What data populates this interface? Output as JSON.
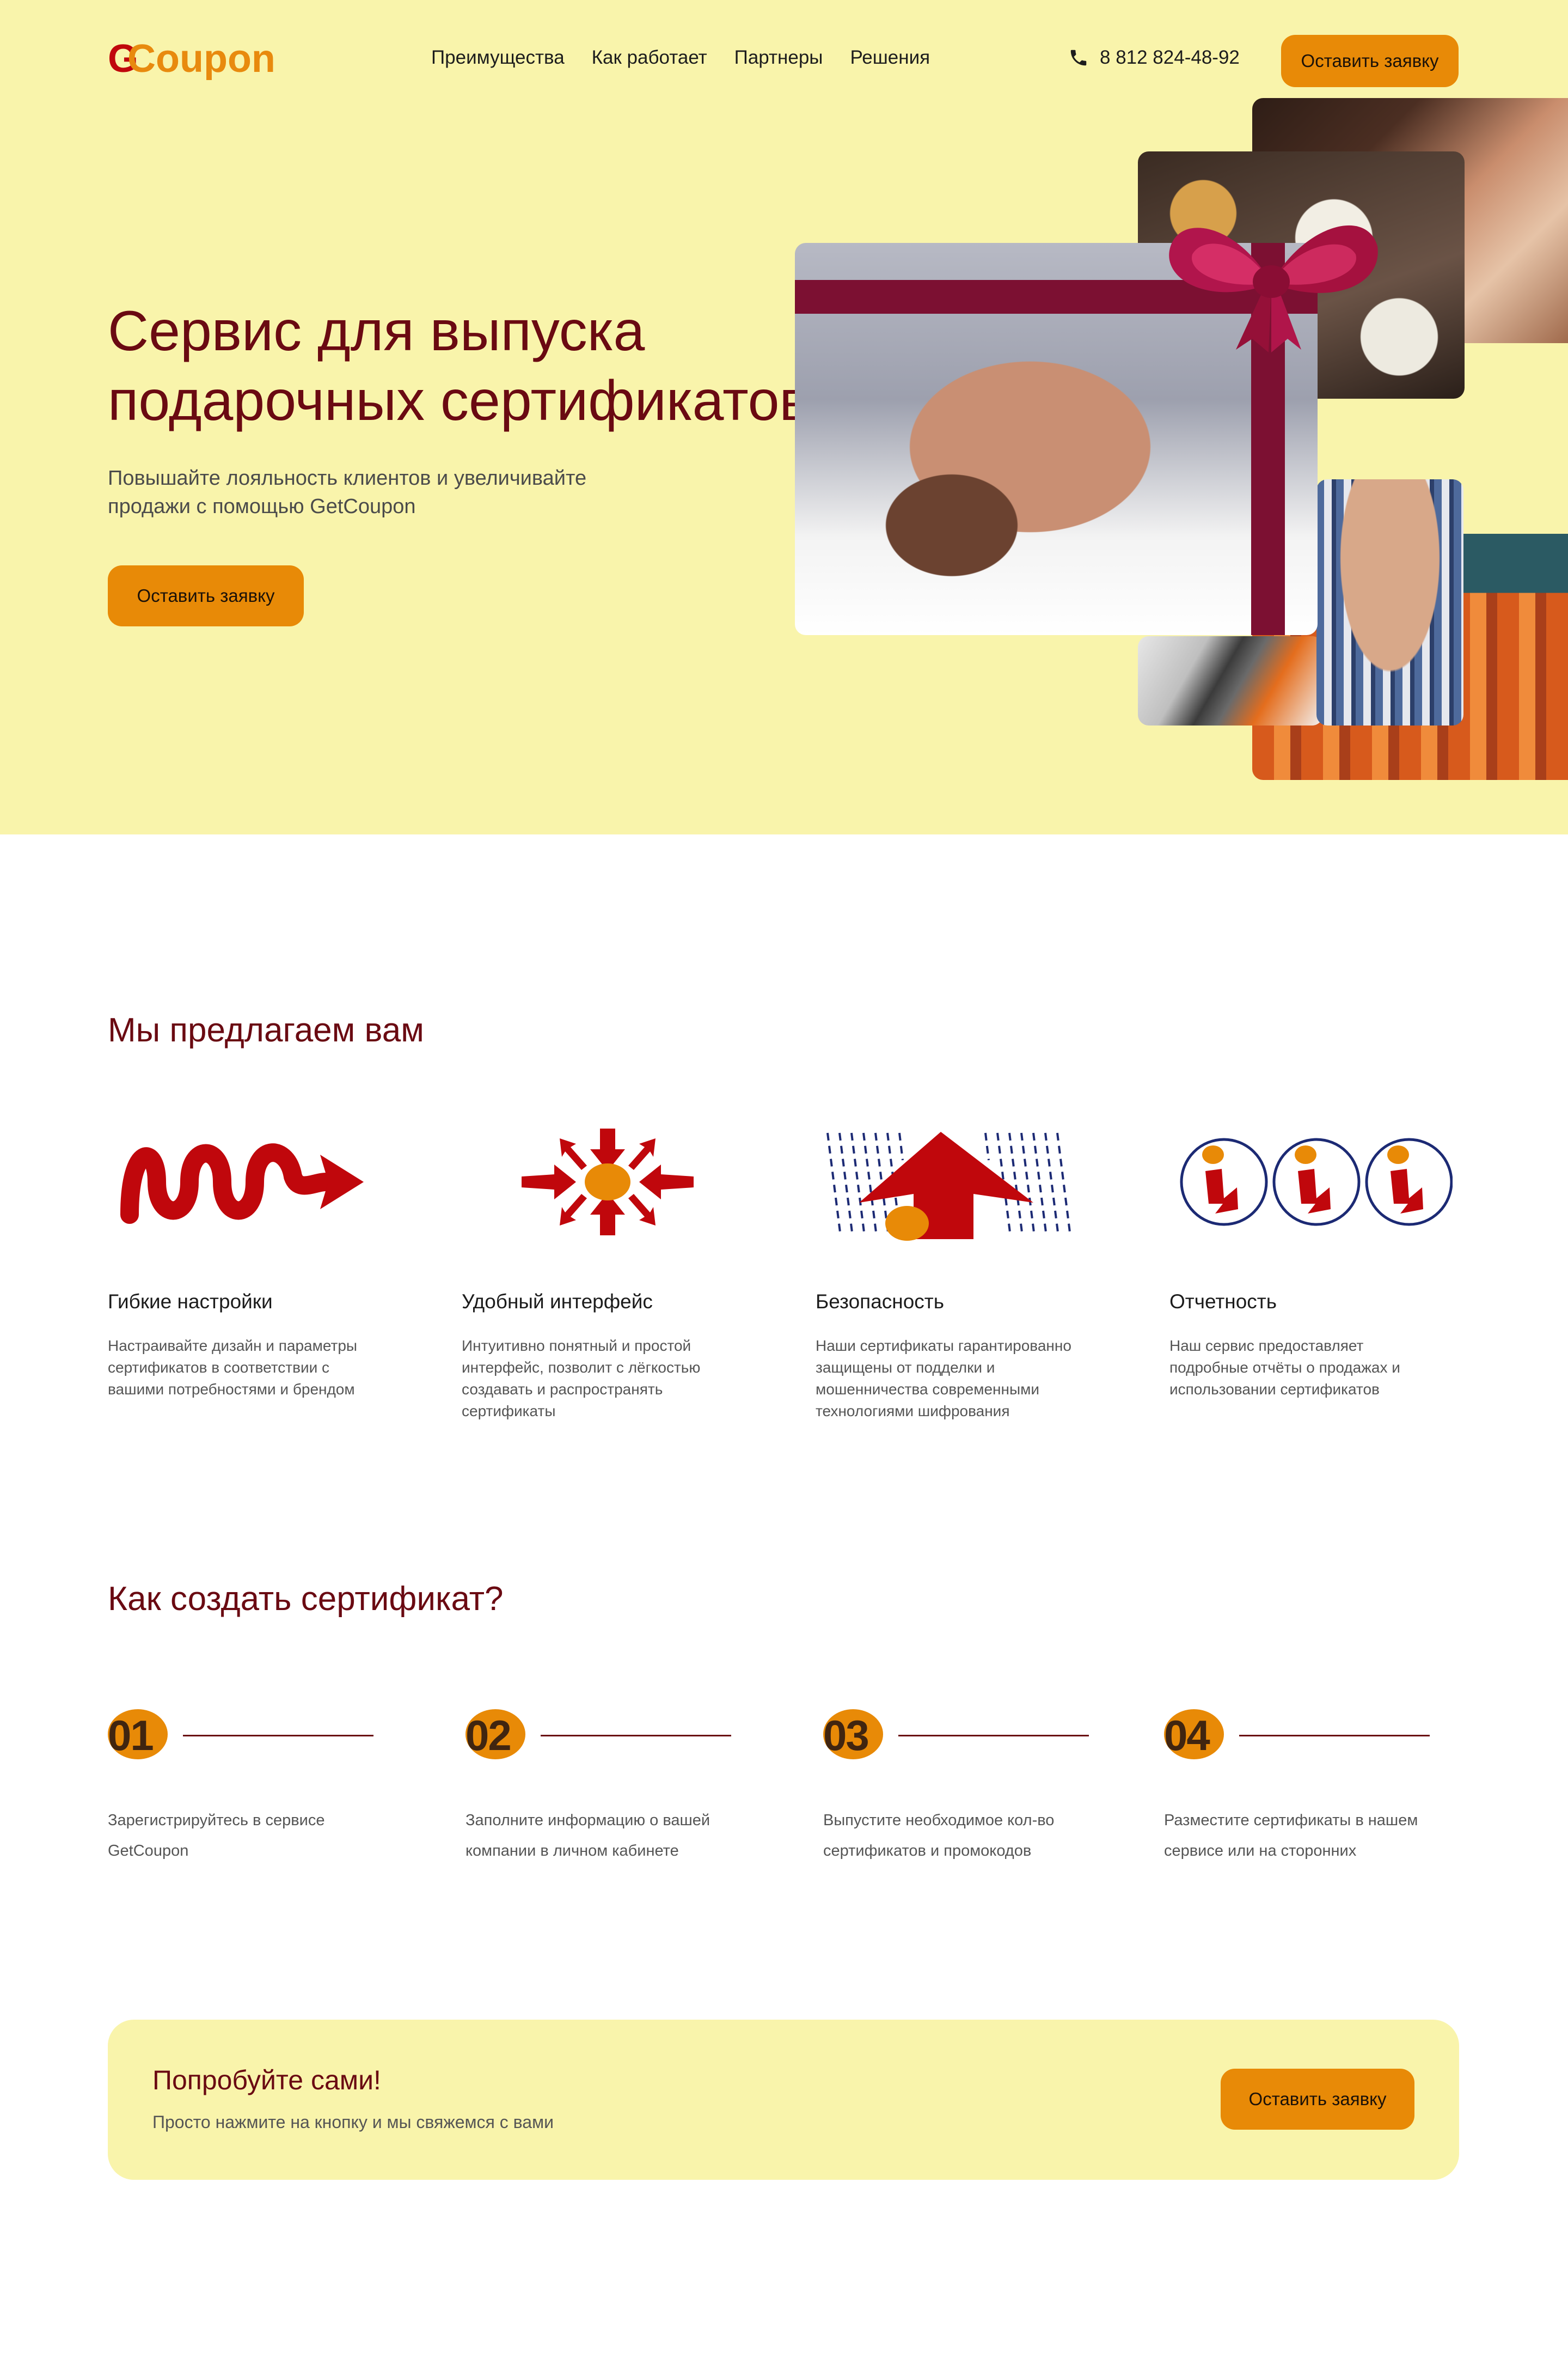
{
  "header": {
    "logo_g": "G",
    "logo_text": "Coupon",
    "nav": [
      "Преимущества",
      "Как работает",
      "Партнеры",
      "Решения"
    ],
    "phone": "8 812 824-48-92",
    "cta_label": "Оставить заявку"
  },
  "hero": {
    "title_line1": "Сервис для выпуска",
    "title_line2": "подарочных сертификатов",
    "subtitle_line1": "Повышайте лояльность клиентов и увеличивайте",
    "subtitle_line2": "продажи с помощью GetCoupon",
    "cta_label": "Оставить заявку"
  },
  "offer": {
    "title": "Мы предлагаем вам",
    "features": [
      {
        "name": "Гибкие настройки",
        "desc": "Настраивайте дизайн и параметры сертификатов в соответствии с вашими потребностями и брендом"
      },
      {
        "name": "Удобный интерфейс",
        "desc": "Интуитивно понятный и простой интерфейс, позволит с лёгкостью создавать и распространять сертификаты"
      },
      {
        "name": "Безопасность",
        "desc": "Наши сертификаты гарантированно защищены от подделки и мошенничества современными технологиями шифрования"
      },
      {
        "name": "Отчетность",
        "desc": "Наш сервис предоставляет подробные отчёты о продажах и использовании сертификатов"
      }
    ]
  },
  "steps": {
    "title": "Как создать сертификат?",
    "items": [
      {
        "num": "01",
        "text": "Зарегистрируйтесь  в сервисе GetCoupon"
      },
      {
        "num": "02",
        "text": "Заполните информацию  о вашей компании  в личном кабинете"
      },
      {
        "num": "03",
        "text": "Выпустите необходимое кол-во сертификатов  и промокодов"
      },
      {
        "num": "04",
        "text": "Разместите сертификаты  в нашем сервисе или на сторонних"
      }
    ]
  },
  "cta": {
    "title": "Попробуйте сами!",
    "subtitle": "Просто нажмите на кнопку и мы свяжемся с вами",
    "button_label": "Оставить заявку"
  },
  "colors": {
    "hero_bg": "#f9f4ab",
    "accent": "#e88a07",
    "title": "#6a0a12",
    "icon_red": "#c0070c",
    "icon_blue": "#1c2a74"
  }
}
